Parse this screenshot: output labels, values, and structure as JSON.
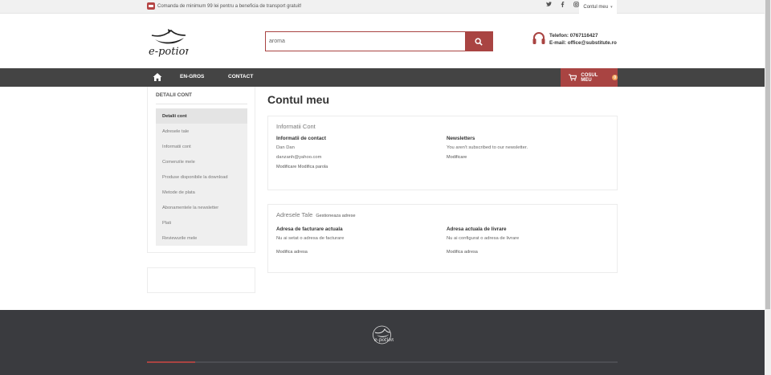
{
  "topbar": {
    "promo_text": "Comanda de minimum 99 lei pentru a beneficia de transport gratuit!",
    "social_icons": [
      "twitter-icon",
      "facebook-icon",
      "instagram-icon"
    ],
    "account_label": "Contul meu"
  },
  "header": {
    "logo_text": "e-potion",
    "search_value": "aroma",
    "phone": "Telefon: 0767116427",
    "email": "E-mail: office@substitute.ro"
  },
  "nav": {
    "items": [
      "EN-GROS",
      "CONTACT"
    ],
    "cart_label": "COSUL MEU",
    "cart_count": "0"
  },
  "sidebar": {
    "title": "DETALII CONT",
    "items": [
      "Detalii cont",
      "Adresele tale",
      "Informatii cont",
      "Comenzile mele",
      "Produse disponibile la download",
      "Metode de plata",
      "Abonamentele la newsletter",
      "Plati",
      "Reviewurile mele"
    ]
  },
  "main": {
    "page_title": "Contul meu",
    "info_panel": {
      "title": "Informatii Cont",
      "contact_heading": "Informatii de contact",
      "name": "Dan Dan",
      "email": "danzanh@yahoo.com",
      "contact_links": "Modificare  Modifica parola",
      "newsletter_heading": "Newsletters",
      "newsletter_text": "You aren't subscribed to our newsletter.",
      "newsletter_link": "Modificare"
    },
    "address_panel": {
      "title": "Adresele Tale",
      "manage_link": "Gestioneaza adrese",
      "billing_heading": "Adresa de facturare actuala",
      "billing_text": "Nu ai setat o adresa de facturare",
      "billing_link": "Modifica adresa",
      "shipping_heading": "Adresa actuala de livrare",
      "shipping_text": "Nu ai configurat o adresa de livrare",
      "shipping_link": "Modifica adresa"
    }
  },
  "colors": {
    "accent": "#a94442",
    "nav_bg": "#444444",
    "footer_bg": "#3a3b3f"
  }
}
